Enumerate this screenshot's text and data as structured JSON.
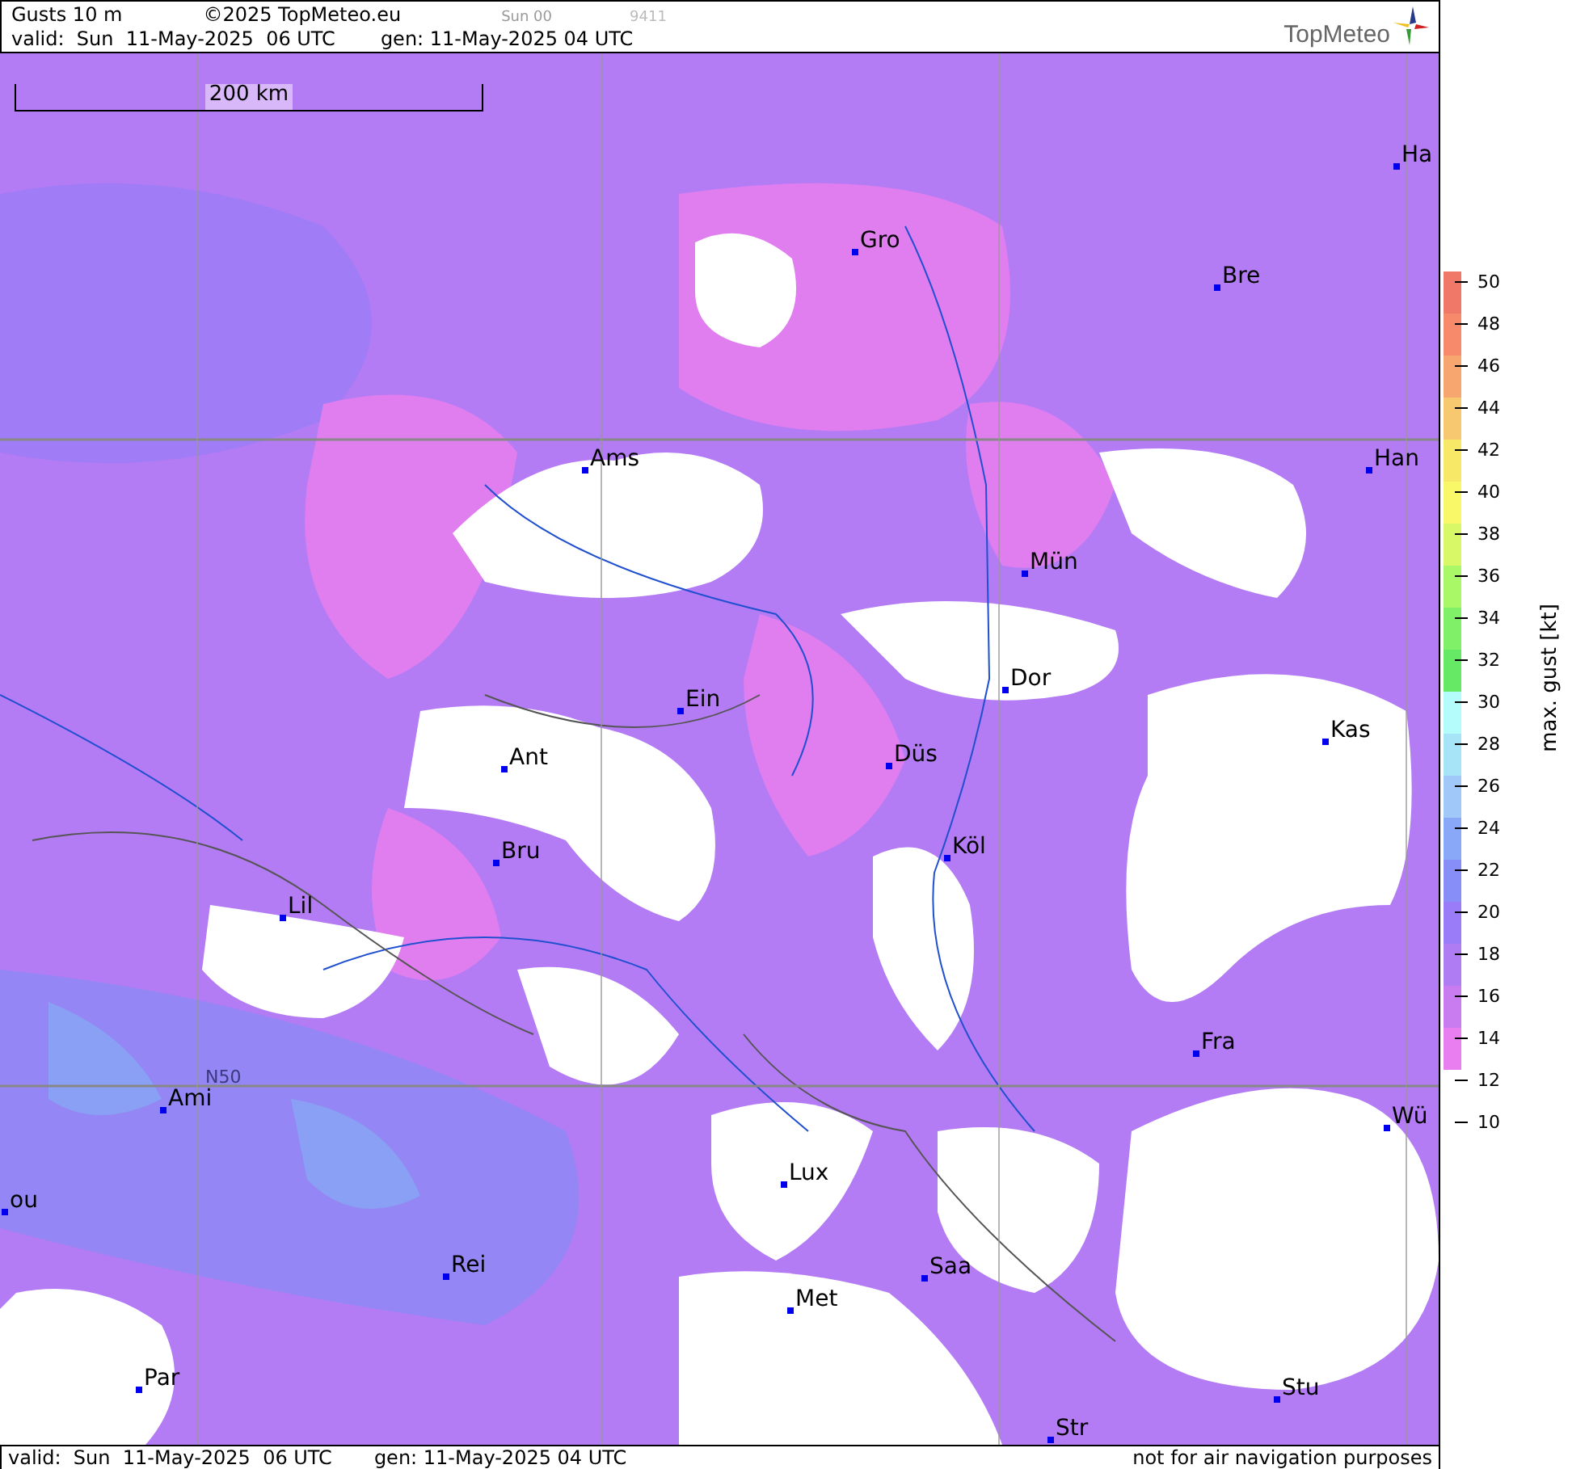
{
  "header": {
    "title": "Gusts 10 m",
    "copyright": "©2025 TopMeteo.eu",
    "run": "Sun 00",
    "code": "9411",
    "valid": "valid:  Sun  11-May-2025  06 UTC",
    "gen": "gen: 11-May-2025 04 UTC",
    "logo": "TopMeteo"
  },
  "map": {
    "scale_label": "200 km",
    "grid_label": "N50",
    "cities": [
      {
        "name": "Ha"
      },
      {
        "name": "Gro"
      },
      {
        "name": "Bre"
      },
      {
        "name": "Ams"
      },
      {
        "name": "Han"
      },
      {
        "name": "Mün"
      },
      {
        "name": "Dor"
      },
      {
        "name": "Ein"
      },
      {
        "name": "Kas"
      },
      {
        "name": "Ant"
      },
      {
        "name": "Düs"
      },
      {
        "name": "Köl"
      },
      {
        "name": "Bru"
      },
      {
        "name": "Lil"
      },
      {
        "name": "Fra"
      },
      {
        "name": "Ami"
      },
      {
        "name": "Wü"
      },
      {
        "name": "Lux"
      },
      {
        "name": "ou"
      },
      {
        "name": "Rei"
      },
      {
        "name": "Saa"
      },
      {
        "name": "Met"
      },
      {
        "name": "Par"
      },
      {
        "name": "Stu"
      },
      {
        "name": "Str"
      }
    ]
  },
  "legend": {
    "title": "max. gust [kt]",
    "ticks": [
      "50",
      "48",
      "46",
      "44",
      "42",
      "40",
      "38",
      "36",
      "34",
      "32",
      "30",
      "28",
      "26",
      "24",
      "22",
      "20",
      "18",
      "16",
      "14",
      "12",
      "10"
    ],
    "bands": [
      {
        "color": "#f07868"
      },
      {
        "color": "#f88a6c"
      },
      {
        "color": "#f8a670"
      },
      {
        "color": "#f8c870"
      },
      {
        "color": "#f8e868"
      },
      {
        "color": "#f8f868"
      },
      {
        "color": "#d8f868"
      },
      {
        "color": "#a8f868"
      },
      {
        "color": "#80f068"
      },
      {
        "color": "#66ea66"
      },
      {
        "color": "#b4fcfc"
      },
      {
        "color": "#a8e4f8"
      },
      {
        "color": "#a0c8f8"
      },
      {
        "color": "#8aa8f8"
      },
      {
        "color": "#888ef8"
      },
      {
        "color": "#9a7cf8"
      },
      {
        "color": "#b07cf4"
      },
      {
        "color": "#c87cf0"
      },
      {
        "color": "#e87ef0"
      }
    ]
  },
  "footer": {
    "valid": "valid:  Sun  11-May-2025  06 UTC",
    "gen": "gen: 11-May-2025 04 UTC",
    "note": "not for air navigation purposes"
  }
}
